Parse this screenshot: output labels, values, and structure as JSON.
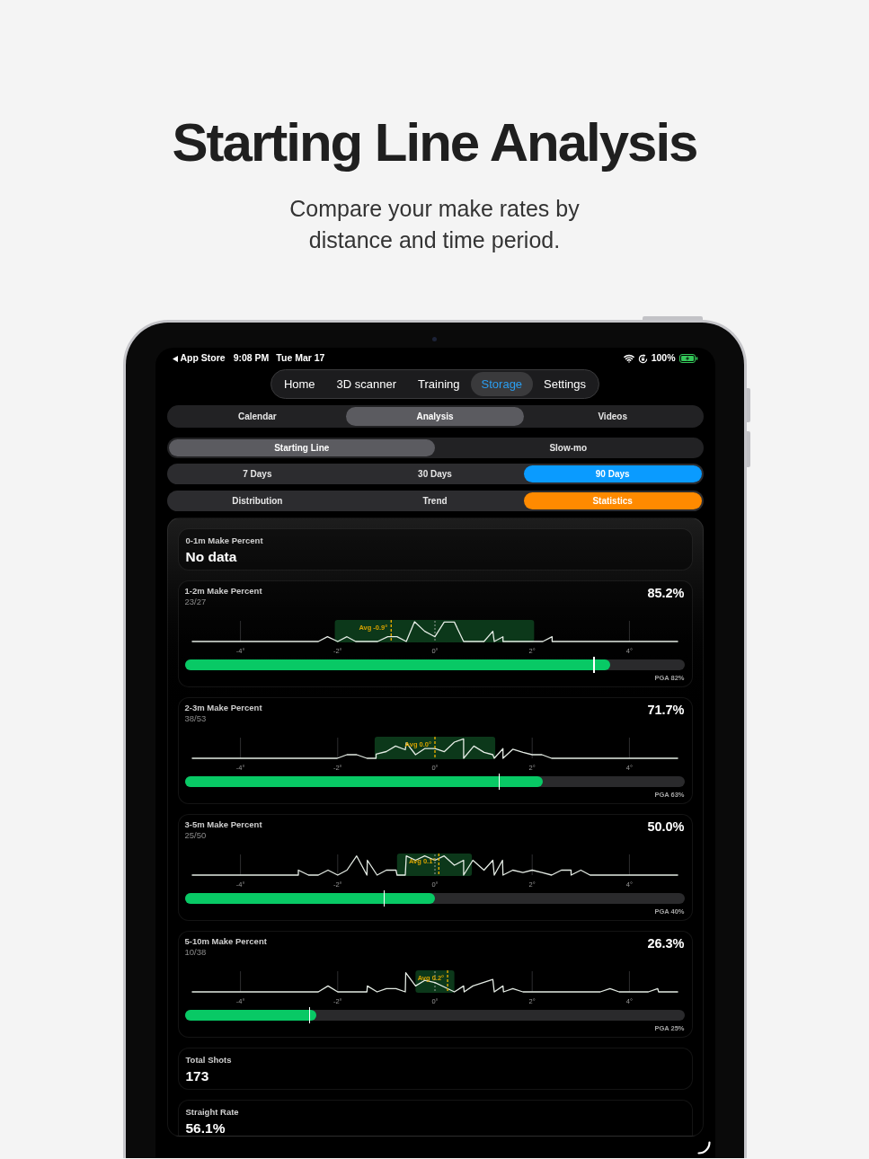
{
  "hero": {
    "title": "Starting Line Analysis",
    "subtitle": "Compare your make rates by distance and time period."
  },
  "status_bar": {
    "back_label": "App Store",
    "time": "9:08 PM",
    "date": "Tue Mar 17",
    "battery": "100%"
  },
  "nav_tabs": [
    {
      "label": "Home",
      "selected": false
    },
    {
      "label": "3D scanner",
      "selected": false
    },
    {
      "label": "Training",
      "selected": false
    },
    {
      "label": "Storage",
      "selected": true
    },
    {
      "label": "Settings",
      "selected": false
    }
  ],
  "section_tabs": [
    {
      "label": "Calendar",
      "selected": false
    },
    {
      "label": "Analysis",
      "selected": true
    },
    {
      "label": "Videos",
      "selected": false
    }
  ],
  "mode_tabs": [
    {
      "label": "Starting Line",
      "selected": true
    },
    {
      "label": "Slow-mo",
      "selected": false
    }
  ],
  "period_tabs": [
    {
      "label": "7 Days",
      "selected": false
    },
    {
      "label": "30 Days",
      "selected": false
    },
    {
      "label": "90 Days",
      "selected": true
    }
  ],
  "view_tabs": [
    {
      "label": "Distribution",
      "selected": false
    },
    {
      "label": "Trend",
      "selected": false
    },
    {
      "label": "Statistics",
      "selected": true
    }
  ],
  "cards": [
    {
      "kind": "stat",
      "title": "0-1m Make Percent",
      "value": "No data"
    },
    {
      "kind": "distribution",
      "title": "1-2m Make Percent",
      "count": "23/27",
      "percent": "85.2%",
      "avg_label": "Avg -0.9°",
      "axis_labels": [
        "-4°",
        "-2°",
        "0°",
        "2°",
        "4°"
      ],
      "bar": {
        "level": 0.852,
        "pga": {
          "level": 0.82,
          "label": "PGA 82%"
        }
      }
    },
    {
      "kind": "distribution",
      "title": "2-3m Make Percent",
      "count": "38/53",
      "percent": "71.7%",
      "avg_label": "Avg 0.0°",
      "axis_labels": [
        "-4°",
        "-2°",
        "0°",
        "2°",
        "4°"
      ],
      "bar": {
        "level": 0.717,
        "pga": {
          "level": 0.63,
          "label": "PGA 63%"
        }
      }
    },
    {
      "kind": "distribution",
      "title": "3-5m Make Percent",
      "count": "25/50",
      "percent": "50.0%",
      "avg_label": "Avg 0.1°",
      "axis_labels": [
        "-4°",
        "-2°",
        "0°",
        "2°",
        "4°"
      ],
      "bar": {
        "level": 0.5,
        "pga": {
          "level": 0.4,
          "label": "PGA 40%"
        }
      }
    },
    {
      "kind": "distribution",
      "title": "5-10m Make Percent",
      "count": "10/38",
      "percent": "26.3%",
      "avg_label": "Avg 0.2°",
      "axis_labels": [
        "-4°",
        "-2°",
        "0°",
        "2°",
        "4°"
      ],
      "bar": {
        "level": 0.263,
        "pga": {
          "level": 0.25,
          "label": "PGA 25%"
        }
      }
    },
    {
      "kind": "stat",
      "title": "Total Shots",
      "value": "173"
    },
    {
      "kind": "stat",
      "title": "Straight Rate",
      "value": "56.1%"
    }
  ]
}
